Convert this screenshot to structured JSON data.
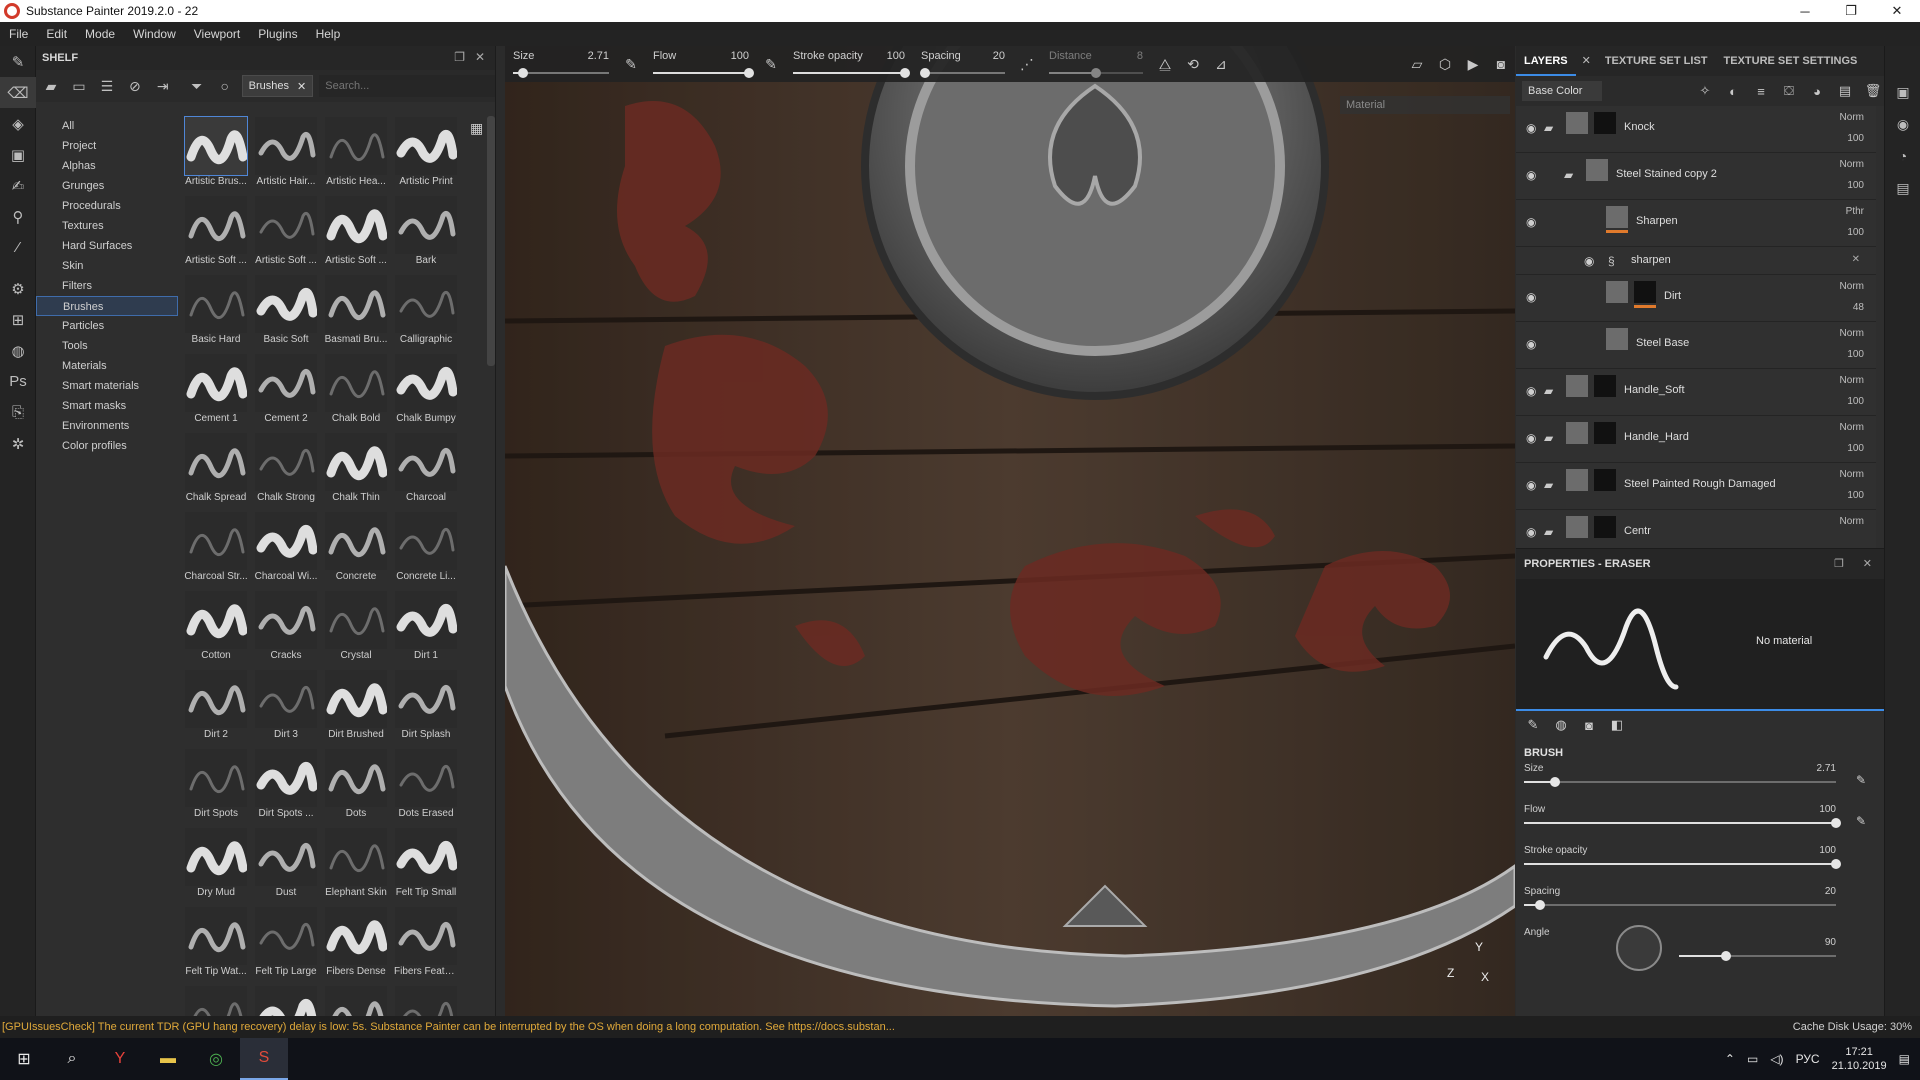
{
  "window": {
    "title": "Substance Painter 2019.2.0 - 22",
    "min": "─",
    "max": "❐",
    "close": "✕"
  },
  "menu": [
    "File",
    "Edit",
    "Mode",
    "Window",
    "Viewport",
    "Plugins",
    "Help"
  ],
  "left_tools": [
    "brush-icon",
    "eraser-icon",
    "projection-icon",
    "geometry-mask-icon",
    "smudge-icon",
    "clone-icon",
    "color-picker-icon",
    "settings-icon",
    "bake-icon",
    "bucket-icon",
    "photoshop-icon",
    "export-icon",
    "gear-icon"
  ],
  "shelf": {
    "title": "SHELF",
    "filter_chip": "Brushes",
    "search_placeholder": "Search...",
    "categories": [
      "All",
      "Project",
      "Alphas",
      "Grunges",
      "Procedurals",
      "Textures",
      "Hard Surfaces",
      "Skin",
      "Filters",
      "Brushes",
      "Particles",
      "Tools",
      "Materials",
      "Smart materials",
      "Smart masks",
      "Environments",
      "Color profiles"
    ],
    "selected_category": "Brushes",
    "items": [
      "Artistic Brus...",
      "Artistic Hair...",
      "Artistic Hea...",
      "Artistic Print",
      "Artistic Soft ...",
      "Artistic Soft ...",
      "Artistic Soft ...",
      "Bark",
      "Basic Hard",
      "Basic Soft",
      "Basmati Bru...",
      "Calligraphic",
      "Cement 1",
      "Cement 2",
      "Chalk Bold",
      "Chalk Bumpy",
      "Chalk Spread",
      "Chalk Strong",
      "Chalk Thin",
      "Charcoal",
      "Charcoal Str...",
      "Charcoal Wi...",
      "Concrete",
      "Concrete Li...",
      "Cotton",
      "Cracks",
      "Crystal",
      "Dirt 1",
      "Dirt 2",
      "Dirt 3",
      "Dirt Brushed",
      "Dirt Splash",
      "Dirt Spots",
      "Dirt Spots ...",
      "Dots",
      "Dots Erased",
      "Dry Mud",
      "Dust",
      "Elephant Skin",
      "Felt Tip Small",
      "Felt Tip Wat...",
      "Felt Tip Large",
      "Fibers Dense",
      "Fibers Feather",
      "",
      "",
      "",
      ""
    ]
  },
  "viewport": {
    "size": {
      "label": "Size",
      "value": "2.71",
      "pct": 0.1
    },
    "flow": {
      "label": "Flow",
      "value": "100",
      "pct": 1.0
    },
    "opacity": {
      "label": "Stroke opacity",
      "value": "100",
      "pct": 1.0
    },
    "spacing": {
      "label": "Spacing",
      "value": "20",
      "pct": 0.05
    },
    "distance": {
      "label": "Distance",
      "value": "8",
      "pct": 0.5
    },
    "material_dd": "Material",
    "axis": {
      "y": "Y",
      "z": "Z",
      "x": "X"
    }
  },
  "layers_panel": {
    "tabs": [
      "LAYERS",
      "TEXTURE SET LIST",
      "TEXTURE SET SETTINGS"
    ],
    "channel": "Base Color",
    "layers": [
      {
        "name": "Knock",
        "mode": "Norm",
        "opacity": "100"
      },
      {
        "name": "Steel Stained copy 2",
        "mode": "Norm",
        "opacity": "100"
      },
      {
        "name": "Sharpen",
        "mode": "Pthr",
        "opacity": "100"
      },
      {
        "name": "sharpen",
        "mode": "",
        "opacity": ""
      },
      {
        "name": "Dirt",
        "mode": "Norm",
        "opacity": "48"
      },
      {
        "name": "Steel Base",
        "mode": "Norm",
        "opacity": "100"
      },
      {
        "name": "Handle_Soft",
        "mode": "Norm",
        "opacity": "100"
      },
      {
        "name": "Handle_Hard",
        "mode": "Norm",
        "opacity": "100"
      },
      {
        "name": "Steel Painted Rough Damaged",
        "mode": "Norm",
        "opacity": "100"
      },
      {
        "name": "Centr",
        "mode": "Norm",
        "opacity": ""
      }
    ]
  },
  "properties": {
    "title": "PROPERTIES - ERASER",
    "material": "No material",
    "section": "BRUSH",
    "sliders": [
      {
        "label": "Size",
        "value": "2.71",
        "pct": 0.1
      },
      {
        "label": "Flow",
        "value": "100",
        "pct": 1.0
      },
      {
        "label": "Stroke opacity",
        "value": "100",
        "pct": 1.0
      },
      {
        "label": "Spacing",
        "value": "20",
        "pct": 0.05
      }
    ],
    "angle": {
      "label": "Angle",
      "value": "90",
      "pct": 0.3
    }
  },
  "status": {
    "message": "[GPUIssuesCheck] The current TDR (GPU hang recovery) delay is low: 5s. Substance Painter can be interrupted by the OS when doing a long computation. See https://docs.substan...",
    "cache": "Cache Disk Usage:   30%"
  },
  "taskbar": {
    "lang": "РУС",
    "time": "17:21",
    "date": "21.10.2019"
  }
}
